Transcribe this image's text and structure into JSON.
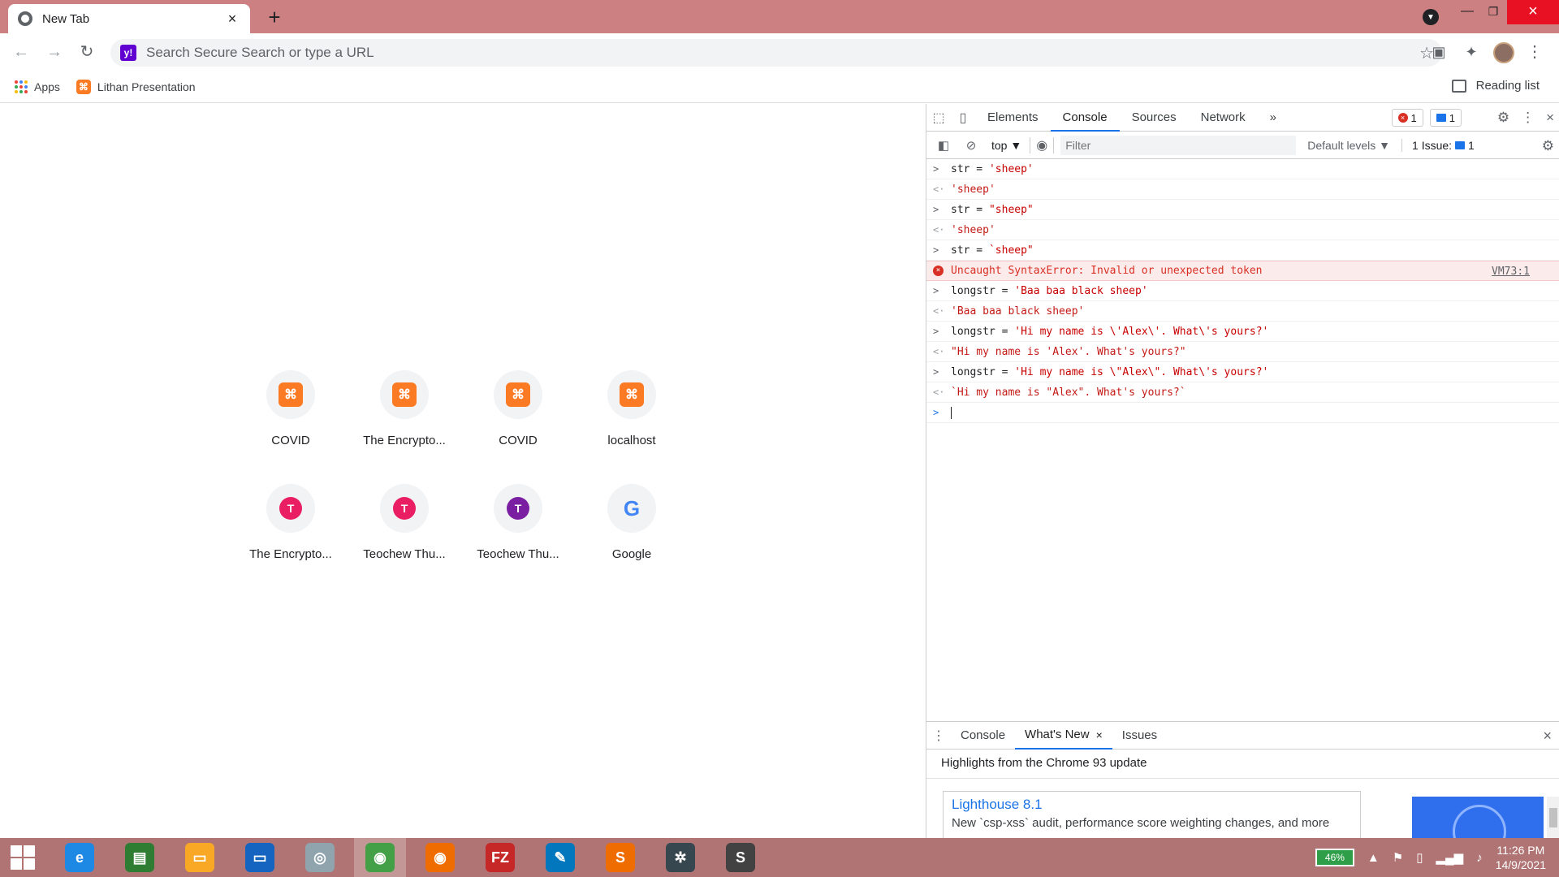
{
  "browser": {
    "tab_title": "New Tab",
    "tab_close": "×",
    "new_tab": "+",
    "omnibox_placeholder": "Search Secure Search or type a URL",
    "reading_list": "Reading list"
  },
  "bookmarks": [
    {
      "label": "Apps",
      "icon": "apps-grid-icon"
    },
    {
      "label": "Lithan Presentation",
      "icon": "xampp-icon"
    }
  ],
  "tiles": [
    {
      "label": "COVID",
      "icon": "xampp-icon"
    },
    {
      "label": "The Encrypto...",
      "icon": "xampp-icon"
    },
    {
      "label": "COVID",
      "icon": "xampp-icon"
    },
    {
      "label": "localhost",
      "icon": "xampp-icon"
    },
    {
      "label": "The Encrypto...",
      "letter": "T",
      "color": "#e91e63"
    },
    {
      "label": "Teochew Thu...",
      "letter": "T",
      "color": "#e91e63"
    },
    {
      "label": "Teochew Thu...",
      "letter": "T",
      "color": "#7b1fa2"
    },
    {
      "label": "Google",
      "icon": "google-icon"
    }
  ],
  "devtools": {
    "tabs": [
      "Elements",
      "Console",
      "Sources",
      "Network"
    ],
    "active_tab": "Console",
    "more": "»",
    "error_count": "1",
    "message_count": "1",
    "context": "top ▼",
    "filter_placeholder": "Filter",
    "levels": "Default levels ▼",
    "issues": "1 Issue:",
    "issues_count": "1"
  },
  "console": [
    {
      "type": "input",
      "var": "str",
      "op": " = ",
      "value": "'sheep'"
    },
    {
      "type": "result",
      "value": "'sheep'"
    },
    {
      "type": "input",
      "var": "str",
      "op": " = ",
      "value": "\"sheep\""
    },
    {
      "type": "result",
      "value": "'sheep'"
    },
    {
      "type": "input",
      "var": "str",
      "op": " = ",
      "value": "`sheep\""
    },
    {
      "type": "error",
      "value": "Uncaught SyntaxError: Invalid or unexpected token",
      "source": "VM73:1"
    },
    {
      "type": "input",
      "var": "longstr",
      "op": " = ",
      "value": "'Baa baa black sheep'"
    },
    {
      "type": "result",
      "value": "'Baa baa black sheep'"
    },
    {
      "type": "input",
      "var": "longstr",
      "op": " = ",
      "value": "'Hi my name is \\'Alex\\'. What\\'s yours?'"
    },
    {
      "type": "result",
      "value": "\"Hi my name is 'Alex'. What's yours?\""
    },
    {
      "type": "input",
      "var": "longstr",
      "op": " = ",
      "value": "'Hi my name is \\\"Alex\\\". What\\'s yours?'"
    },
    {
      "type": "result",
      "value": "`Hi my name is \"Alex\". What's yours?`"
    }
  ],
  "drawer": {
    "tabs": [
      "Console",
      "What's New",
      "Issues"
    ],
    "active_tab": "What's New",
    "highlights": "Highlights from the Chrome 93 update",
    "card_title": "Lighthouse 8.1",
    "card_text": "New `csp-xss` audit, performance score weighting changes, and more"
  },
  "taskbar": {
    "apps": [
      {
        "name": "internet-explorer-icon",
        "label": "e",
        "color": "#1e88e5"
      },
      {
        "name": "store-icon",
        "label": "▤",
        "color": "#2e7d32"
      },
      {
        "name": "file-explorer-icon",
        "label": "▭",
        "color": "#f9a825"
      },
      {
        "name": "lenovo-icon",
        "label": "▭",
        "color": "#1565c0"
      },
      {
        "name": "safari-icon",
        "label": "◎",
        "color": "#90a4ae"
      },
      {
        "name": "chrome-icon",
        "label": "◉",
        "color": "#43a047"
      },
      {
        "name": "firefox-icon",
        "label": "◉",
        "color": "#ef6c00"
      },
      {
        "name": "filezilla-icon",
        "label": "FZ",
        "color": "#c62828"
      },
      {
        "name": "quill-icon",
        "label": "✎",
        "color": "#0277bd"
      },
      {
        "name": "sublime-icon",
        "label": "S",
        "color": "#ef6c00"
      },
      {
        "name": "tree-app-icon",
        "label": "✲",
        "color": "#37474f"
      },
      {
        "name": "sublime-alt-icon",
        "label": "S",
        "color": "#424242"
      }
    ],
    "active_app": "chrome-icon",
    "battery": "46%",
    "time": "11:26 PM",
    "date": "14/9/2021"
  }
}
